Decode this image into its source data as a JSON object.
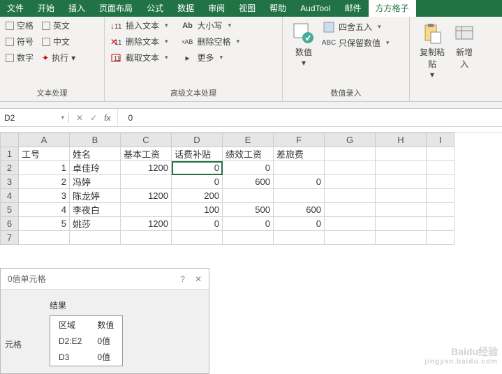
{
  "menu": {
    "tabs": [
      "文件",
      "开始",
      "插入",
      "页面布局",
      "公式",
      "数据",
      "审阅",
      "视图",
      "帮助",
      "AudTool",
      "邮件",
      "方方格子"
    ],
    "active": 11
  },
  "ribbon": {
    "g1": {
      "title": "文本处理",
      "chks": [
        "空格",
        "英文",
        "符号",
        "中文",
        "数字",
        "执行"
      ]
    },
    "g2": {
      "title": "高级文本处理",
      "items": [
        "插入文本",
        "删除文本",
        "截取文本",
        "大小写",
        "删除空格",
        "更多"
      ]
    },
    "g3": {
      "title": "数值录入",
      "big": "数值",
      "items": [
        "四舍五入",
        "只保留数值"
      ]
    },
    "g4": {
      "big1": "复制粘\n贴",
      "big2": "新增\n入"
    }
  },
  "formula": {
    "namebox": "D2",
    "value": "0"
  },
  "cols": [
    "A",
    "B",
    "C",
    "D",
    "E",
    "F",
    "G",
    "H",
    "I"
  ],
  "headers": [
    "工号",
    "姓名",
    "基本工资",
    "话费补贴",
    "绩效工资",
    "差旅费"
  ],
  "rows": [
    {
      "a": "1",
      "b": "卓佳玲",
      "c": "1200",
      "d": "0",
      "e": "0",
      "f": ""
    },
    {
      "a": "2",
      "b": "冯婷",
      "c": "",
      "d": "0",
      "e": "600",
      "f": "0"
    },
    {
      "a": "3",
      "b": "陈龙婷",
      "c": "1200",
      "d": "200",
      "e": "",
      "f": ""
    },
    {
      "a": "4",
      "b": "李夜白",
      "c": "",
      "d": "100",
      "e": "500",
      "f": "600"
    },
    {
      "a": "5",
      "b": "姚莎",
      "c": "1200",
      "d": "0",
      "e": "0",
      "f": "0"
    }
  ],
  "dialog": {
    "title": "0值单元格",
    "result_label": "结果",
    "side": "元格",
    "thead": [
      "区域",
      "数值"
    ],
    "trows": [
      [
        "D2:E2",
        "0值"
      ],
      [
        "D3",
        "0值"
      ]
    ]
  },
  "wm": {
    "brand": "Baidu经验",
    "url": "jingyan.baidu.com"
  }
}
